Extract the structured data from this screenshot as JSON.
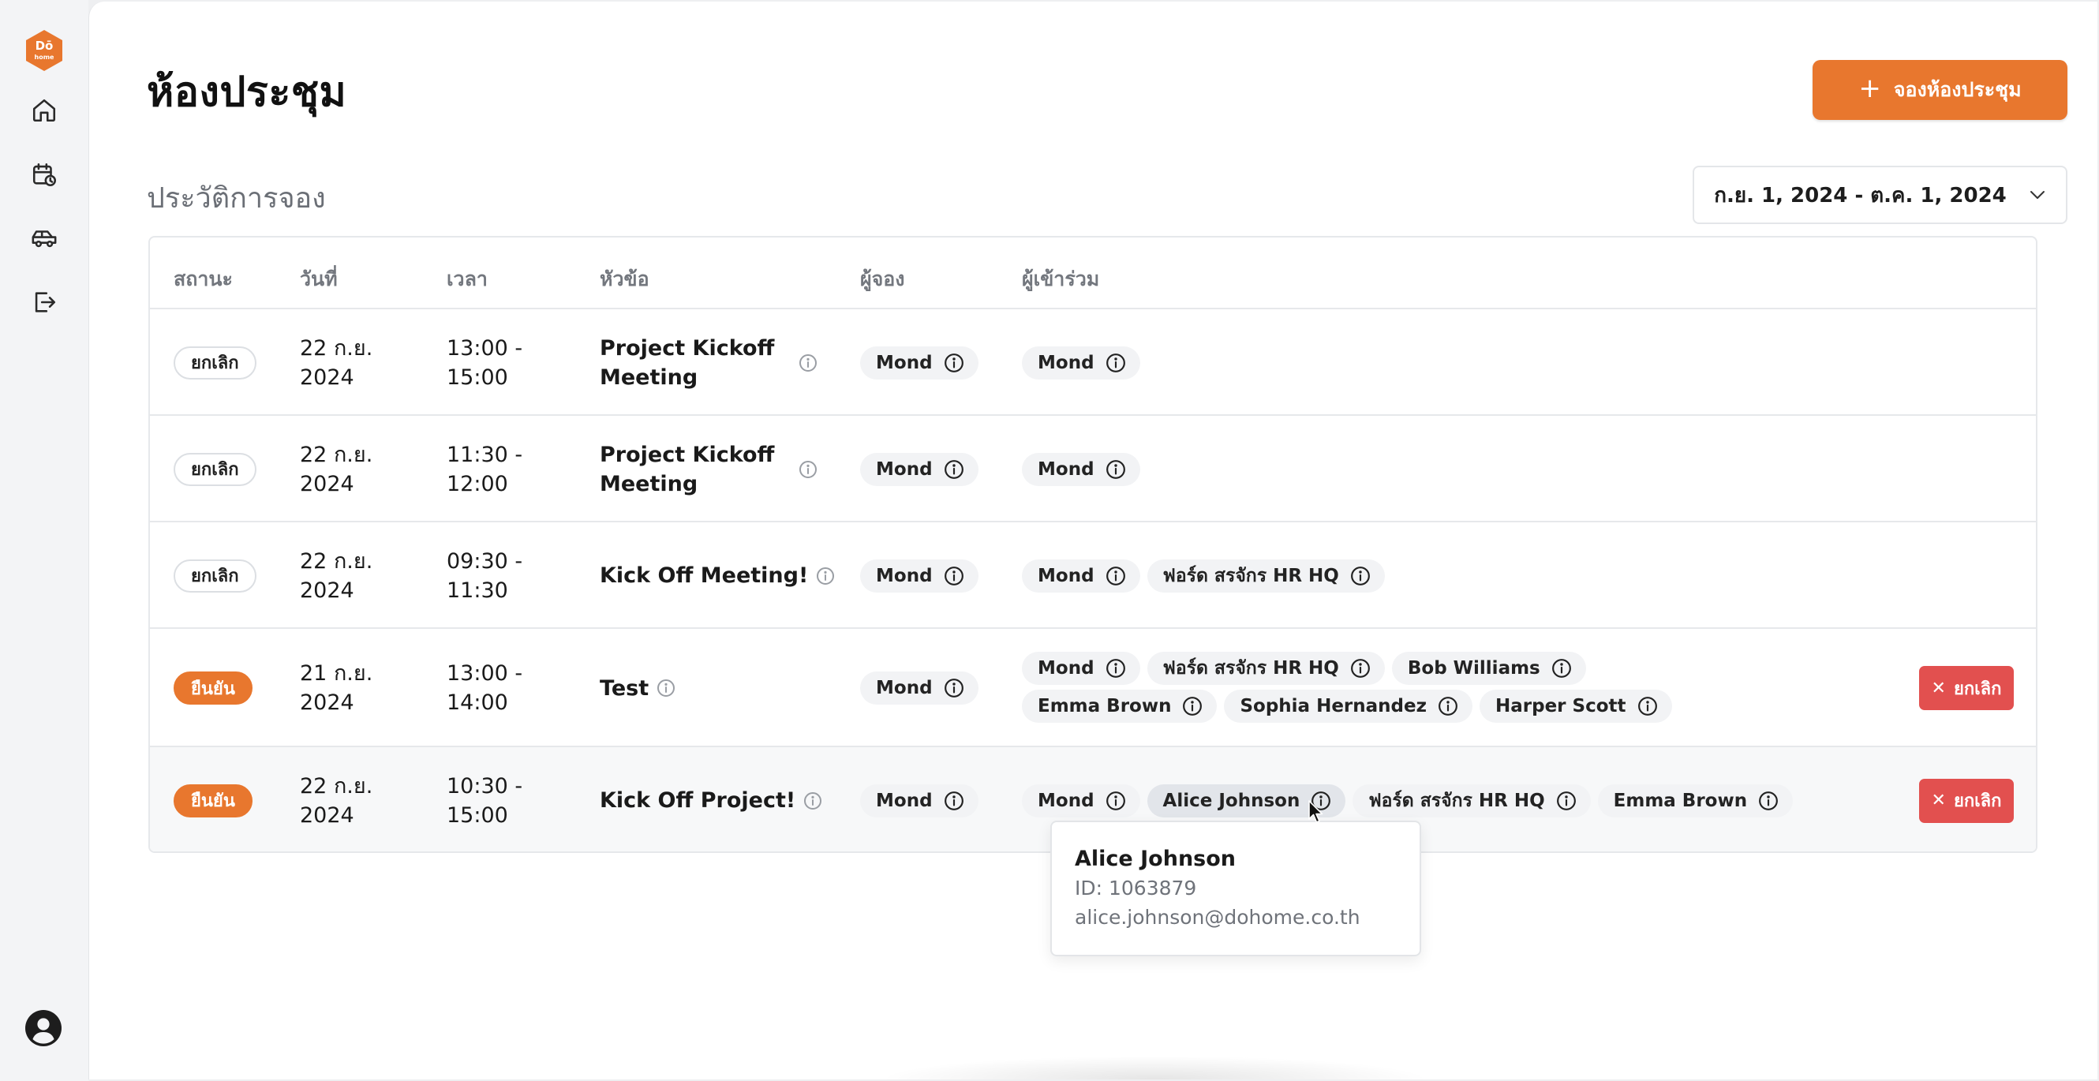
{
  "app": {
    "logo_text": "Dohome",
    "brand_color": "#e8772e",
    "danger_color": "#e2504f"
  },
  "sidebar": {
    "items": [
      {
        "icon": "home-icon"
      },
      {
        "icon": "calendar-clock-icon"
      },
      {
        "icon": "car-icon"
      },
      {
        "icon": "logout-icon"
      }
    ],
    "avatar_icon": "user-avatar-icon"
  },
  "header": {
    "title": "ห้องประชุม",
    "book_button_label": "จองห้องประชุม"
  },
  "history": {
    "title": "ประวัติการจอง",
    "date_range": "ก.ย. 1, 2024 - ต.ค. 1, 2024"
  },
  "table": {
    "columns": [
      "สถานะ",
      "วันที่",
      "เวลา",
      "หัวข้อ",
      "ผู้จอง",
      "ผู้เข้าร่วม"
    ],
    "rows": [
      {
        "status": "ยกเลิก",
        "status_type": "cancelled",
        "date_line1": "22 ก.ย.",
        "date_line2": "2024",
        "time_line1": "13:00 -",
        "time_line2": "15:00",
        "topic_line1": "Project Kickoff",
        "topic_line2": "Meeting",
        "booker": "Mond",
        "attendees": [
          "Mond"
        ],
        "action": ""
      },
      {
        "status": "ยกเลิก",
        "status_type": "cancelled",
        "date_line1": "22 ก.ย.",
        "date_line2": "2024",
        "time_line1": "11:30 -",
        "time_line2": "12:00",
        "topic_line1": "Project Kickoff",
        "topic_line2": "Meeting",
        "booker": "Mond",
        "attendees": [
          "Mond"
        ],
        "action": ""
      },
      {
        "status": "ยกเลิก",
        "status_type": "cancelled",
        "date_line1": "22 ก.ย.",
        "date_line2": "2024",
        "time_line1": "09:30 -",
        "time_line2": "11:30",
        "topic_line1": "Kick Off Meeting!",
        "topic_line2": "",
        "booker": "Mond",
        "attendees": [
          "Mond",
          "ฟอร์ด สรจักร HR HQ"
        ],
        "action": ""
      },
      {
        "status": "ยืนยัน",
        "status_type": "confirmed",
        "date_line1": "21 ก.ย.",
        "date_line2": "2024",
        "time_line1": "13:00 -",
        "time_line2": "14:00",
        "topic_line1": "Test",
        "topic_line2": "",
        "booker": "Mond",
        "attendees": [
          "Mond",
          "ฟอร์ด สรจักร HR HQ",
          "Bob Williams",
          "Emma Brown",
          "Sophia Hernandez",
          "Harper Scott"
        ],
        "action": "ยกเลิก"
      },
      {
        "status": "ยืนยัน",
        "status_type": "confirmed",
        "date_line1": "22 ก.ย.",
        "date_line2": "2024",
        "time_line1": "10:30 -",
        "time_line2": "15:00",
        "topic_line1": "Kick Off Project!",
        "topic_line2": "",
        "booker": "Mond",
        "attendees": [
          "Mond",
          "Alice Johnson",
          "ฟอร์ด สรจักร HR HQ",
          "Emma Brown"
        ],
        "action": "ยกเลิก"
      }
    ]
  },
  "tooltip": {
    "name": "Alice Johnson",
    "id_line": "ID: 1063879",
    "email": "alice.johnson@dohome.co.th"
  }
}
